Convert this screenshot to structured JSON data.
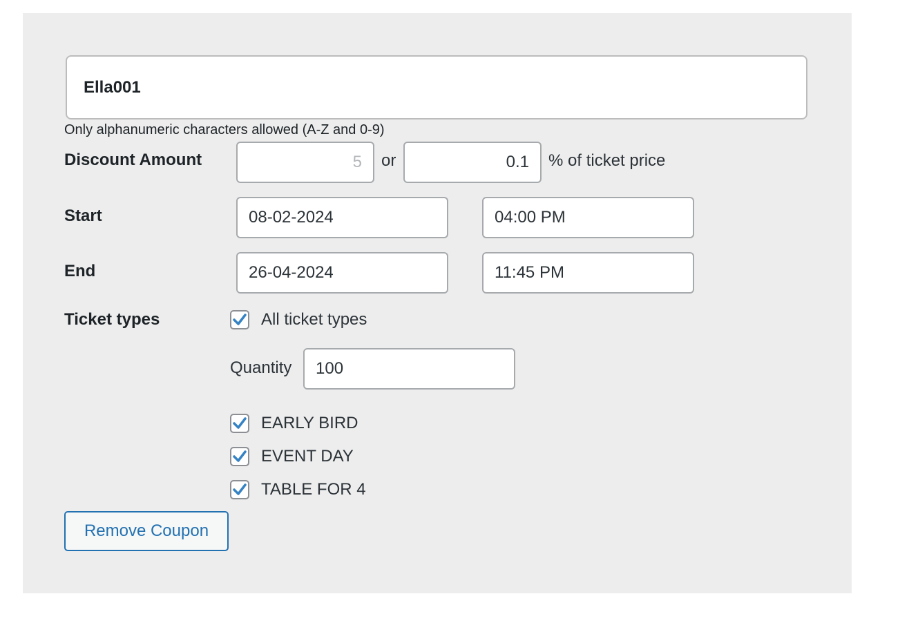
{
  "coupon": {
    "code_value": "Ella001",
    "code_help": "Only alphanumeric characters allowed (A-Z and 0-9)"
  },
  "discount": {
    "label": "Discount Amount",
    "amount_placeholder": "5",
    "or_text": "or",
    "percent_value": "0.1",
    "percent_suffix": "% of ticket price"
  },
  "start": {
    "label": "Start",
    "date": "08-02-2024",
    "time": "04:00 PM"
  },
  "end": {
    "label": "End",
    "date": "26-04-2024",
    "time": "11:45 PM"
  },
  "ticket_types": {
    "label": "Ticket types",
    "all_label": "All ticket types",
    "all_checked": true,
    "quantity_label": "Quantity",
    "quantity_value": "100",
    "items": [
      {
        "label": "EARLY BIRD",
        "checked": true
      },
      {
        "label": "EVENT DAY",
        "checked": true
      },
      {
        "label": "TABLE FOR 4",
        "checked": true
      }
    ]
  },
  "actions": {
    "remove_label": "Remove Coupon"
  },
  "colors": {
    "panel_bg": "#ededed",
    "accent": "#2271b1",
    "check": "#3582c4"
  }
}
